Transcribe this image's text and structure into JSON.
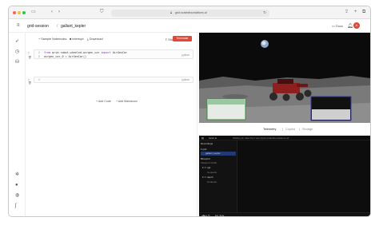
{
  "browser": {
    "url": "grid.scaledfoundations.ai",
    "colors": {
      "close": "#ff5f57",
      "minimize": "#febc2e",
      "zoom": "#28c840"
    }
  },
  "header": {
    "breadcrumb_root": "grid-session",
    "breadcrumb_sep": "/",
    "breadcrumb_current": "gallant_kepler",
    "docs_label": "Docs",
    "avatar_initial": "A"
  },
  "toolbar": {
    "sample_notebooks": "+ Sample Notebooks",
    "interrupt": "Interrupt",
    "download": "Download",
    "share": "Share",
    "terminate": "Terminate"
  },
  "cells": [
    {
      "lang": "python",
      "lines": [
        {
          "kw": "from",
          "text": " grid.robot.wheeled.airgen_car ",
          "kw2": "import",
          "rest": " AirGenCar"
        },
        {
          "kw": "",
          "text": "airgen_car_0 = AirGenCar()",
          "kw2": "",
          "rest": ""
        }
      ]
    },
    {
      "lang": "python",
      "lines": []
    }
  ],
  "actions": {
    "add_code": "+ Add Code",
    "add_markdown": "+ Add Markdown"
  },
  "right_tabs": {
    "telemetry": "Telemetry",
    "copilot": "Copilot",
    "storage": "Storage"
  },
  "viewer": {
    "app_name": "rerun.io",
    "status": "Waiting for data from wss://grid.scaledfoundations.ai/...",
    "recordings_label": "Recordings",
    "recording_group": "grid",
    "recording_item": "gallant_kepler",
    "blueprint_label": "Blueprint",
    "viewport_label": "Viewport (Grid)",
    "view_a": "rgb",
    "view_b": "depth",
    "content_label": "Contents",
    "timeline_label": "log_time"
  }
}
